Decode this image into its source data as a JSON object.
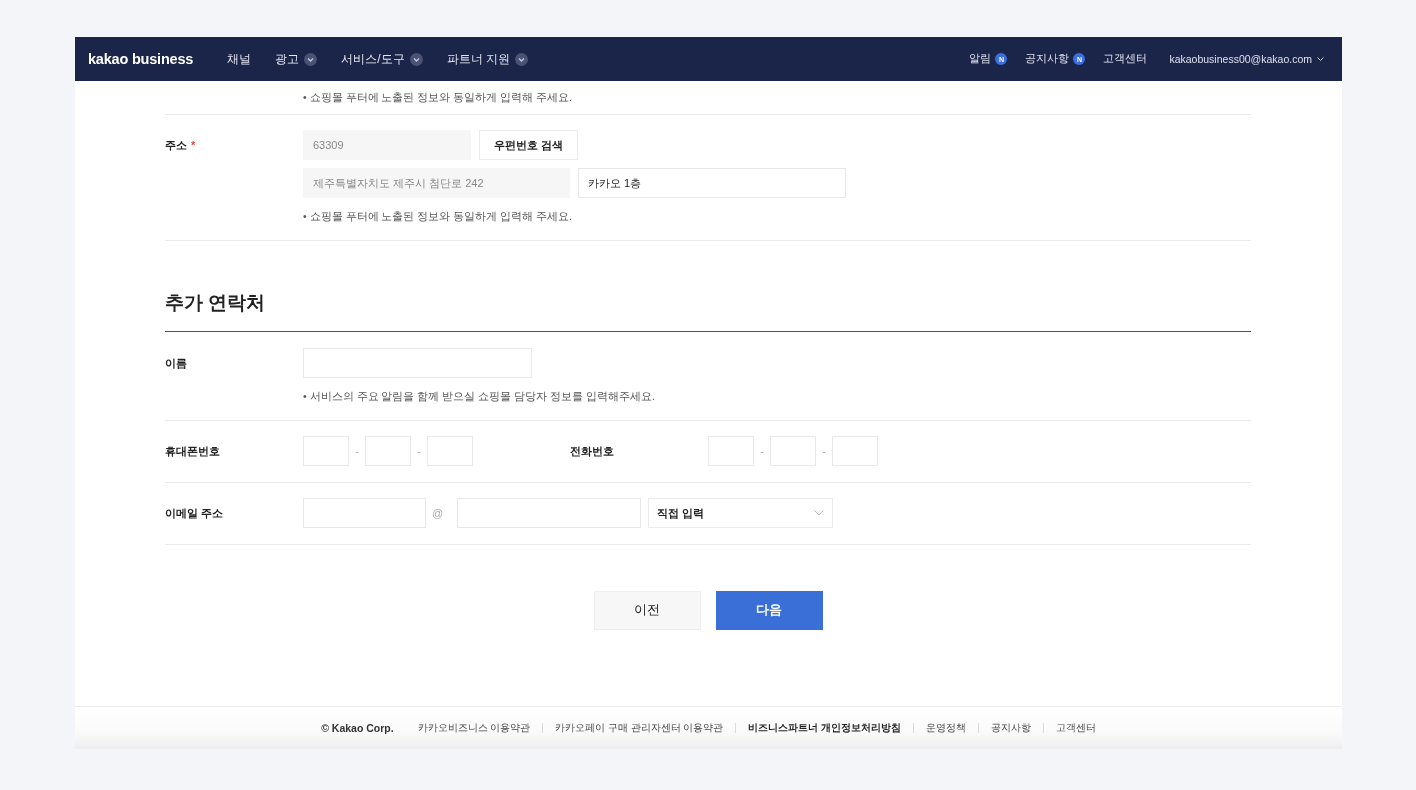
{
  "header": {
    "logo": "kakao business",
    "nav": [
      {
        "label": "채널",
        "dropdown": false
      },
      {
        "label": "광고",
        "dropdown": true
      },
      {
        "label": "서비스/도구",
        "dropdown": true
      },
      {
        "label": "파트너 지원",
        "dropdown": true
      }
    ],
    "links": [
      {
        "label": "알림",
        "badge": "N"
      },
      {
        "label": "공지사항",
        "badge": "N"
      },
      {
        "label": "고객센터"
      }
    ],
    "account": "kakaobusiness00@kakao.com"
  },
  "top_hint": "• 쇼핑몰 푸터에 노출된 정보와 동일하게 입력해 주세요.",
  "address": {
    "label": "주소",
    "required_mark": "*",
    "postcode": {
      "value": "63309",
      "readonly": true
    },
    "search_button": "우편번호 검색",
    "address1": {
      "value": "제주특별자치도 제주시 첨단로 242",
      "readonly": true
    },
    "address2": {
      "value": "카카오 1층",
      "readonly": false
    },
    "hint": "• 쇼핑몰 푸터에 노출된 정보와 동일하게 입력해 주세요."
  },
  "section_title": "추가 연락처",
  "name": {
    "label": "이름",
    "hint": "• 서비스의 주요 알림을 함께 받으실 쇼핑몰 담당자 정보를 입력해주세요."
  },
  "mobile": {
    "label": "휴대폰번호",
    "separators": [
      "-",
      "-"
    ]
  },
  "phone": {
    "label": "전화번호",
    "separators": [
      "-",
      "-"
    ]
  },
  "email": {
    "label": "이메일 주소",
    "at": "@",
    "domain_select": "직접 입력"
  },
  "buttons": [
    {
      "label": "이전",
      "kind": "secondary"
    },
    {
      "label": "다음",
      "kind": "primary"
    }
  ],
  "footer": {
    "copyright": "© Kakao Corp.",
    "links": [
      {
        "label": "카카오비즈니스 이용약관",
        "bold": false
      },
      {
        "label": "카카오페이 구매 관리자센터 이용약관",
        "bold": false
      },
      {
        "label": "비즈니스파트너 개인정보처리방침",
        "bold": true
      },
      {
        "label": "운영정책",
        "bold": false
      },
      {
        "label": "공지사항",
        "bold": false
      },
      {
        "label": "고객센터",
        "bold": false
      }
    ]
  }
}
